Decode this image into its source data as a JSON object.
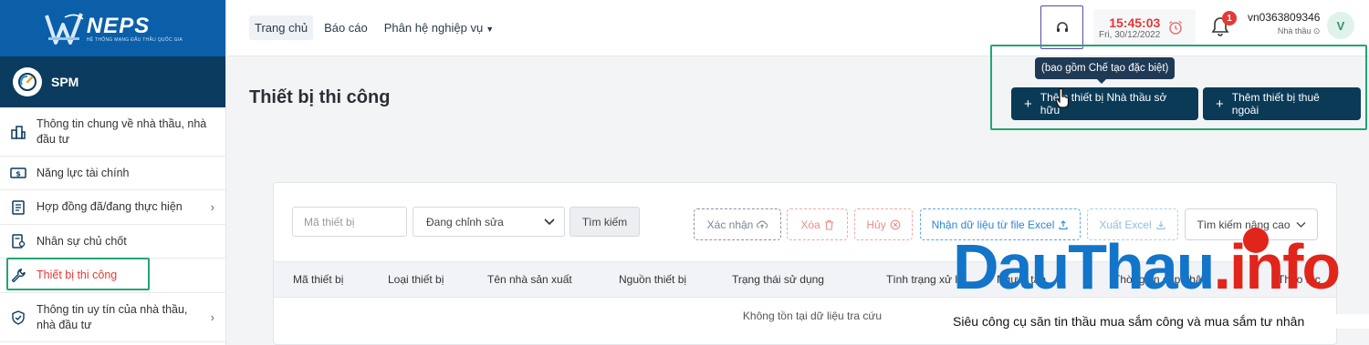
{
  "brand": {
    "logo_name": "NEPS",
    "logo_sub": "HỆ THỐNG MẠNG ĐẤU THẦU QUỐC GIA"
  },
  "sidebar": {
    "module": "SPM",
    "items": [
      {
        "label": "Thông tin chung về nhà thầu, nhà đầu tư",
        "icon": "building-icon",
        "chevron": false
      },
      {
        "label": "Năng lực tài chính",
        "icon": "money-icon",
        "chevron": false
      },
      {
        "label": "Hợp đồng đã/đang thực hiện",
        "icon": "contract-icon",
        "chevron": true
      },
      {
        "label": "Nhân sự chủ chốt",
        "icon": "personnel-icon",
        "chevron": false
      },
      {
        "label": "Thiết bị thi công",
        "icon": "wrench-icon",
        "chevron": false,
        "active": true
      },
      {
        "label": "Thông tin uy tín của nhà thầu, nhà đầu tư",
        "icon": "shield-check-icon",
        "chevron": true
      }
    ]
  },
  "topbar": {
    "nav": [
      {
        "label": "Trang chủ",
        "active": true
      },
      {
        "label": "Báo cáo"
      },
      {
        "label": "Phân hệ nghiệp vụ",
        "dropdown": true
      }
    ],
    "clock_time": "15:45:03",
    "clock_date": "Fri, 30/12/2022",
    "notifications": "1",
    "username": "vn0363809346",
    "role": "Nhà thầu",
    "avatar": "V"
  },
  "main": {
    "title": "Thiết bị thi công",
    "tooltip": "(bao gồm Chế tạo đặc biệt)",
    "add_owned": "Thêm thiết bị Nhà thầu sở hữu",
    "add_rented": "Thêm thiết bị thuê ngoài"
  },
  "filters": {
    "code_placeholder": "Mã thiết bị",
    "status_selected": "Đang chỉnh sửa",
    "search": "Tìm kiếm",
    "confirm": "Xác nhận",
    "delete": "Xóa",
    "cancel": "Hủy",
    "import_excel": "Nhận dữ liệu từ file Excel",
    "export_excel": "Xuất Excel",
    "advanced_search": "Tìm kiếm nâng cao"
  },
  "table": {
    "columns": [
      "Mã thiết bị",
      "Loại thiết bị",
      "Tên nhà sản xuất",
      "Nguồn thiết bị",
      "Trạng thái sử dụng",
      "Tình trạng xử lý",
      "Người tạo",
      "Thời gian cập nhật",
      "Thao tác"
    ],
    "empty": "Không tồn tại dữ liệu tra cứu"
  },
  "watermark": {
    "part1": "DauThau",
    "part2": ".info",
    "tagline": "Siêu công cụ săn tin thầu mua sắm công và mua sắm tư nhân",
    "blue": "#1275c9",
    "red": "#e1251b"
  }
}
